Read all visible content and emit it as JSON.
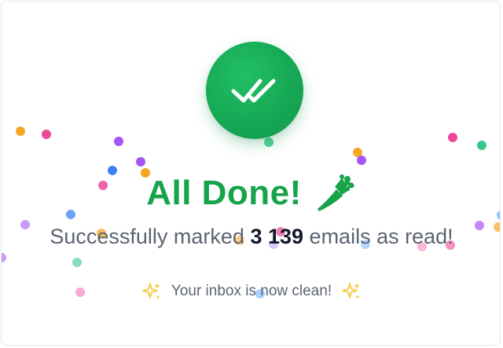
{
  "success": {
    "title": "All Done!",
    "message_prefix": "Successfully marked",
    "count": "3 139",
    "message_suffix": "emails as read!",
    "clean_message": "Your inbox is now clean!"
  },
  "icons": {
    "main": "double-check-icon",
    "title": "broom-icon",
    "sparkle": "sparkle-icon"
  },
  "colors": {
    "success_green": "#17a34a",
    "circle_green": "#16a855",
    "text_gray": "#5c6370",
    "count_dark": "#111827",
    "sparkle_yellow": "#f5c842",
    "confetti": [
      "#f5a623",
      "#ec4899",
      "#a855f7",
      "#3b82f6",
      "#34c88a",
      "#f9a8d4",
      "#93c5fd",
      "#c4b5fd"
    ]
  }
}
